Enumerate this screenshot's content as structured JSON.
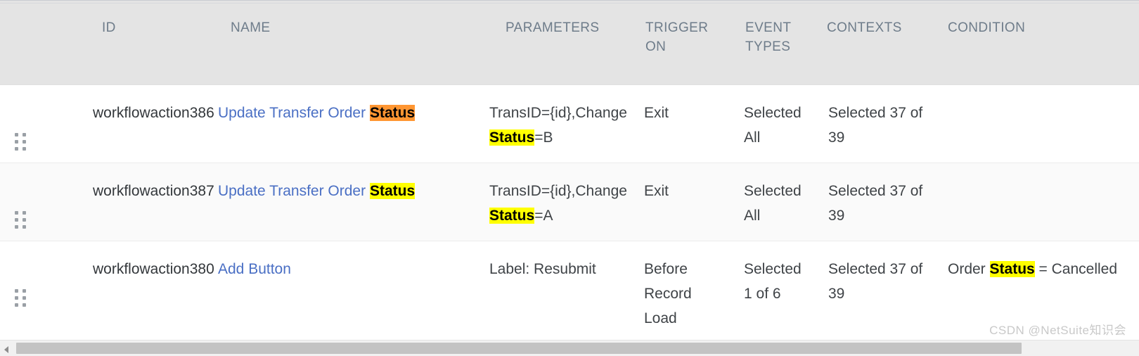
{
  "table": {
    "columns": [
      {
        "key": "handle",
        "label": ""
      },
      {
        "key": "id",
        "label": "ID"
      },
      {
        "key": "name",
        "label": "NAME"
      },
      {
        "key": "params",
        "label": "PARAMETERS"
      },
      {
        "key": "trigger",
        "label": "TRIGGER ON"
      },
      {
        "key": "events",
        "label": "EVENT TYPES"
      },
      {
        "key": "contexts",
        "label": "CONTEXTS"
      },
      {
        "key": "condition",
        "label": "CONDITION"
      }
    ],
    "header_labels": {
      "id": "ID",
      "name": "NAME",
      "parameters": "PARAMETERS",
      "trigger_on_line1": "TRIGGER",
      "trigger_on_line2": "ON",
      "event_types_line1": "EVENT",
      "event_types_line2": "TYPES",
      "contexts": "CONTEXTS",
      "condition": "CONDITION"
    },
    "rows": [
      {
        "id": "workflowaction386",
        "name_prefix": "Update Transfer Order ",
        "name_highlight": "Status",
        "name_highlight_color": "orange",
        "name_full": "Update Transfer Order Status",
        "params_prefix": "TransID={id},Change ",
        "params_highlight": "Status",
        "params_suffix": "=B",
        "params_full": "TransID={id},Change Status=B",
        "trigger_on": "Exit",
        "event_types": "Selected All",
        "contexts": "Selected 37 of 39",
        "condition": "",
        "condition_prefix": "",
        "condition_highlight": "",
        "condition_suffix": ""
      },
      {
        "id": "workflowaction387",
        "name_prefix": "Update Transfer Order ",
        "name_highlight": "Status",
        "name_highlight_color": "yellow",
        "name_full": "Update Transfer Order Status",
        "params_prefix": "TransID={id},Change ",
        "params_highlight": "Status",
        "params_suffix": "=A",
        "params_full": "TransID={id},Change Status=A",
        "trigger_on": "Exit",
        "event_types": "Selected All",
        "contexts": "Selected 37 of 39",
        "condition": "",
        "condition_prefix": "",
        "condition_highlight": "",
        "condition_suffix": ""
      },
      {
        "id": "workflowaction380",
        "name_prefix": "Add Button",
        "name_highlight": "",
        "name_highlight_color": "none",
        "name_full": "Add Button",
        "params_prefix": "Label: Resubmit",
        "params_highlight": "",
        "params_suffix": "",
        "params_full": "Label: Resubmit",
        "trigger_on": "Before Record Load",
        "event_types": "Selected 1 of 6",
        "contexts": "Selected 37 of 39",
        "condition": "Order Status = Cancelled",
        "condition_prefix": "Order ",
        "condition_highlight": "Status",
        "condition_suffix": " = Cancelled"
      }
    ]
  },
  "scrollbar": {
    "left_arrow": "scroll-left-arrow"
  },
  "watermark": {
    "text": "CSDN @NetSuite知识会"
  },
  "colors": {
    "header_bg": "#e4e4e4",
    "header_text": "#6e7c8a",
    "link": "#4a6fc4",
    "highlight_yellow": "#ffff00",
    "highlight_orange": "#ff9632",
    "row_alt_bg": "#fafafa",
    "body_text": "#3f4347"
  }
}
